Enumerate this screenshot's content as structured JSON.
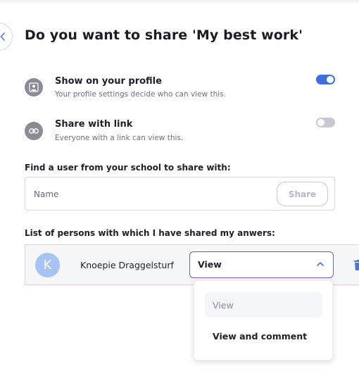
{
  "dialog": {
    "title": "Do you want to share 'My best work'"
  },
  "options": [
    {
      "label": "Show on your profile",
      "description": "Your profile settings decide who can view this.",
      "icon": "profile-icon",
      "enabled": true
    },
    {
      "label": "Share with link",
      "description": "Everyone with a link can view this.",
      "icon": "link-icon",
      "enabled": false
    }
  ],
  "find_user": {
    "label": "Find a user from your school to share with:",
    "placeholder": "Name",
    "share_label": "Share"
  },
  "shared_list": {
    "label": "List of persons with which I have shared my anwers:",
    "persons": [
      {
        "initial": "K",
        "name": "Knoepie Draggelsturf",
        "permission": "View"
      }
    ]
  },
  "permission_dropdown": {
    "options": [
      "View",
      "View and comment"
    ],
    "selected": "View"
  },
  "colors": {
    "accent": "#3d6fe0",
    "select_border": "#7a59b5",
    "avatar": "#a7c3f4",
    "row_border": "#f1c9d2",
    "delete": "#4a78e0"
  }
}
